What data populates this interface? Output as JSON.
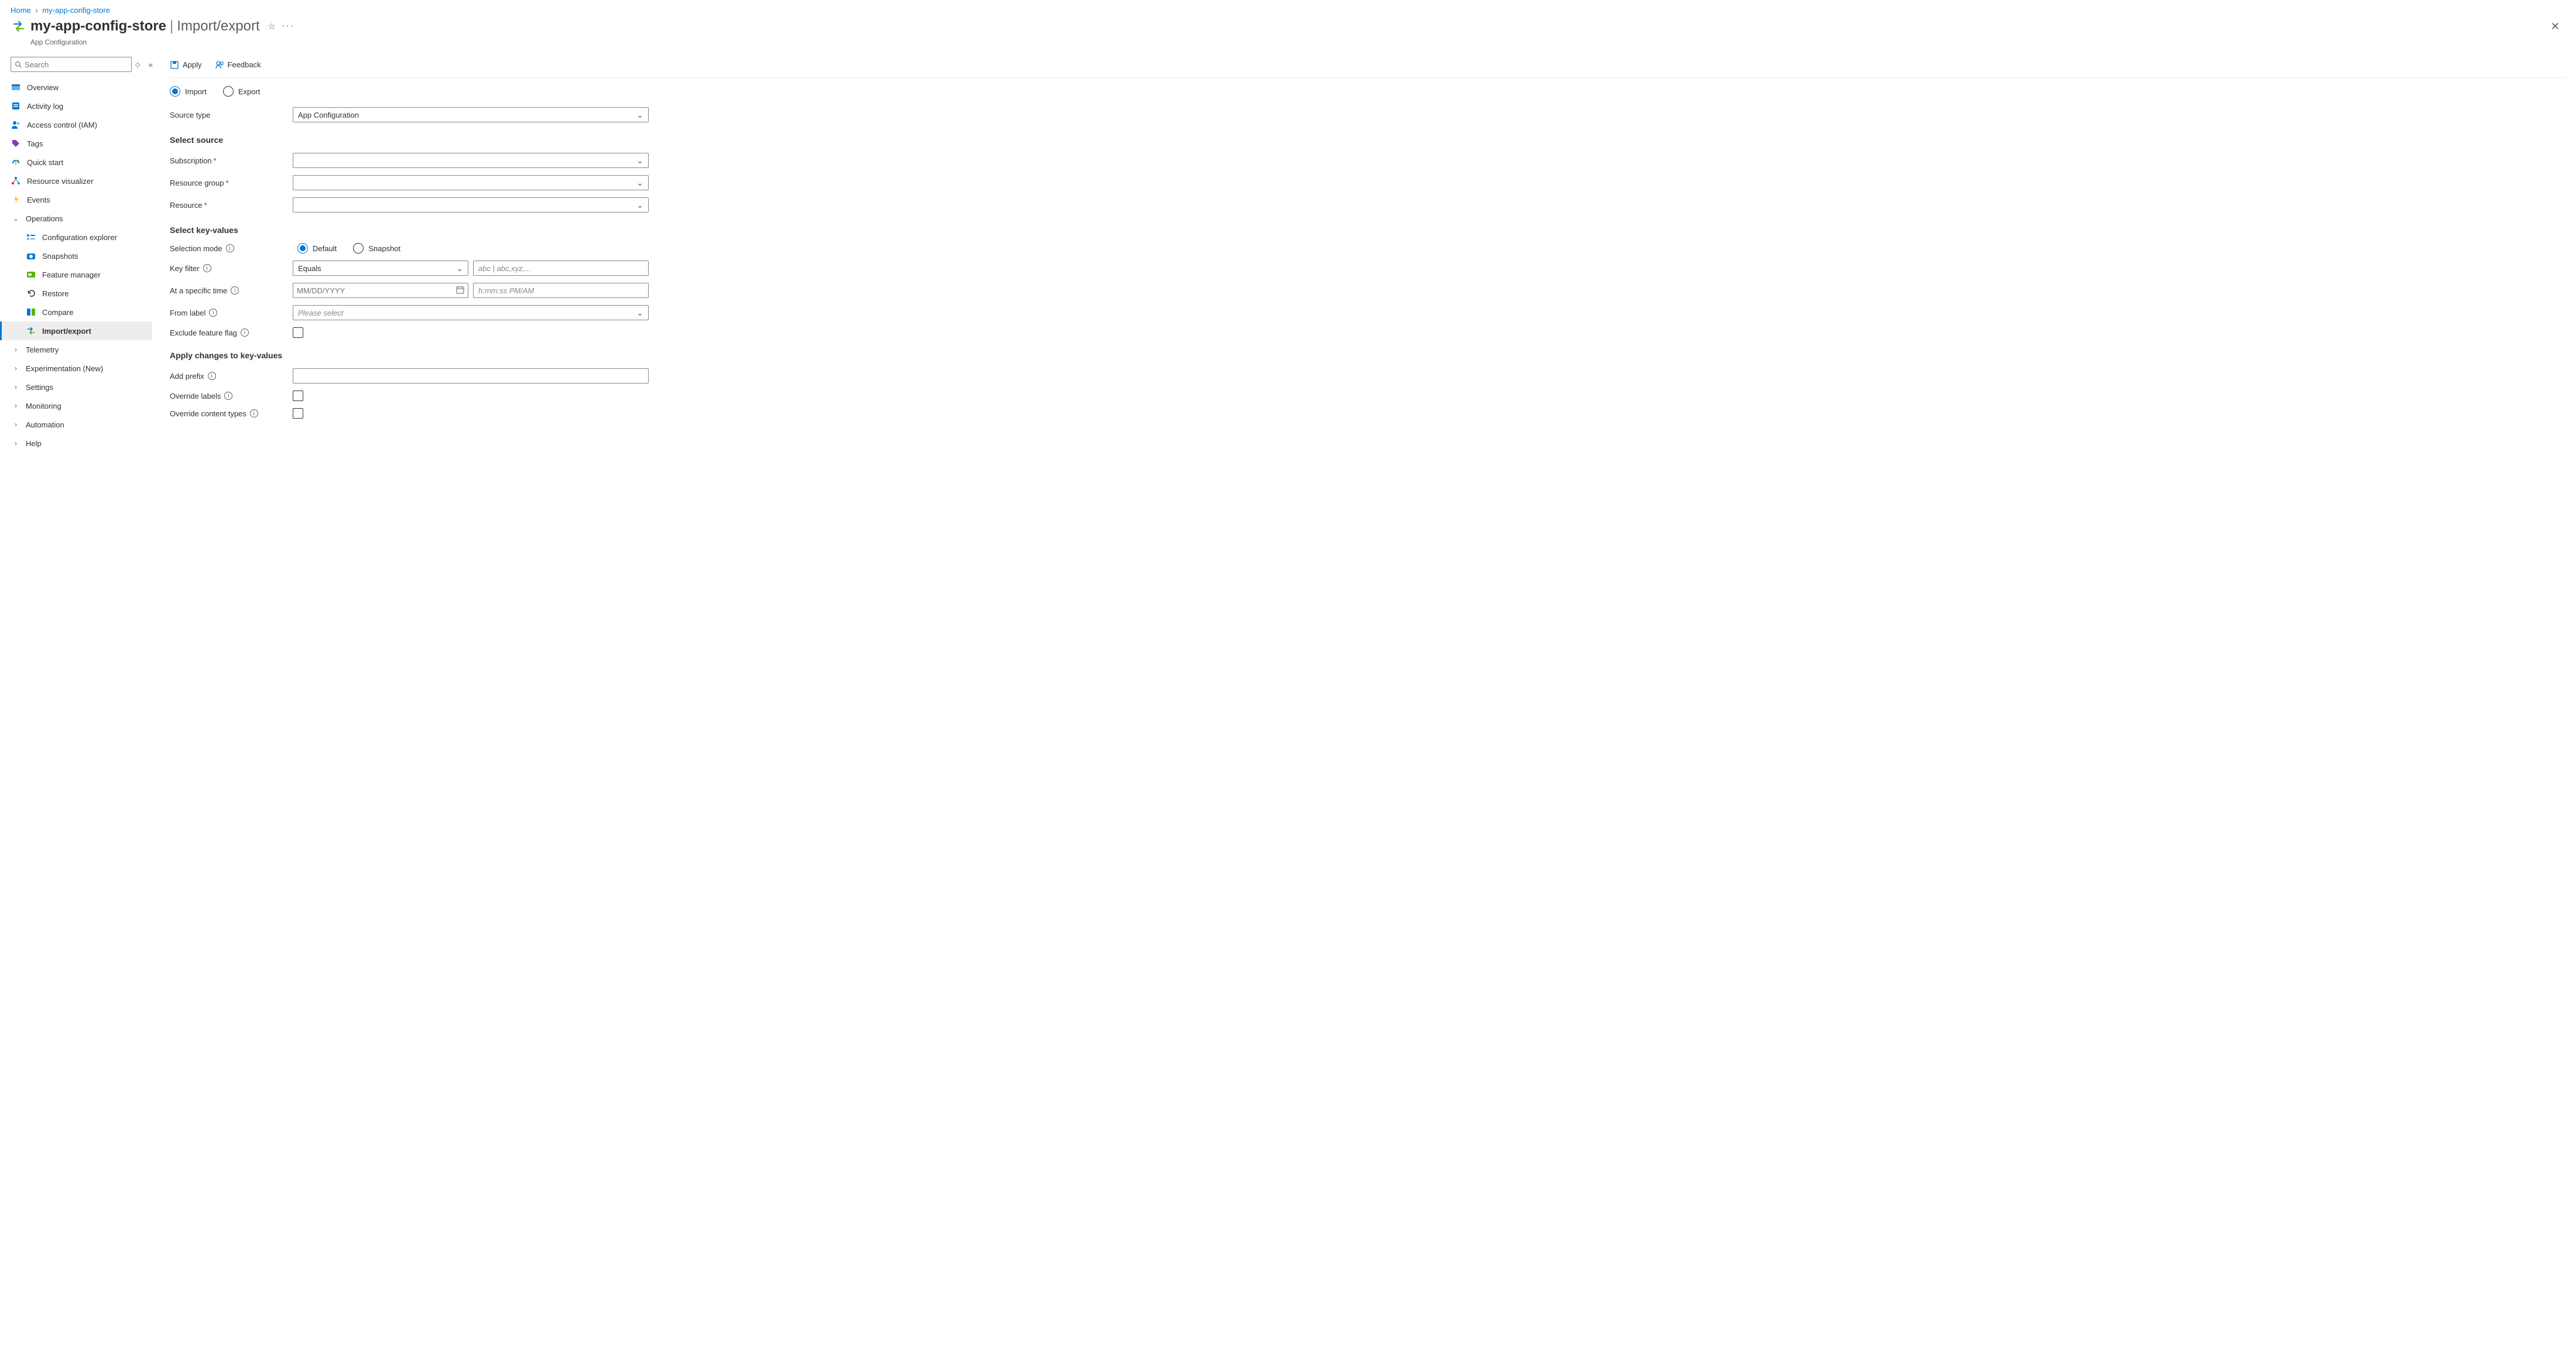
{
  "breadcrumb": {
    "home": "Home",
    "resource": "my-app-config-store"
  },
  "header": {
    "title": "my-app-config-store",
    "page": "Import/export",
    "subtitle": "App Configuration"
  },
  "search": {
    "placeholder": "Search"
  },
  "nav": {
    "overview": "Overview",
    "activity": "Activity log",
    "iam": "Access control (IAM)",
    "tags": "Tags",
    "quickstart": "Quick start",
    "resvis": "Resource visualizer",
    "events": "Events",
    "operations": "Operations",
    "confexp": "Configuration explorer",
    "snapshots": "Snapshots",
    "featmgr": "Feature manager",
    "restore": "Restore",
    "compare": "Compare",
    "importexport": "Import/export",
    "telemetry": "Telemetry",
    "experimentation": "Experimentation (New)",
    "settings": "Settings",
    "monitoring": "Monitoring",
    "automation": "Automation",
    "help": "Help"
  },
  "toolbar": {
    "apply": "Apply",
    "feedback": "Feedback"
  },
  "mode": {
    "import": "Import",
    "export": "Export"
  },
  "fields": {
    "source_type": {
      "label": "Source type",
      "value": "App Configuration"
    },
    "select_source_h": "Select source",
    "subscription": "Subscription",
    "resource_group": "Resource group",
    "resource": "Resource",
    "select_kv_h": "Select key-values",
    "selection_mode": "Selection mode",
    "selmode_default": "Default",
    "selmode_snapshot": "Snapshot",
    "key_filter": "Key filter",
    "key_filter_op": "Equals",
    "key_filter_ph": "abc | abc,xyz,...",
    "at_time": "At a specific time",
    "date_ph": "MM/DD/YYYY",
    "time_ph": "h:mm:ss PM/AM",
    "from_label": "From label",
    "from_label_ph": "Please select",
    "exclude_ff": "Exclude feature flag",
    "apply_changes_h": "Apply changes to key-values",
    "add_prefix": "Add prefix",
    "override_labels": "Override labels",
    "override_ct": "Override content types"
  }
}
